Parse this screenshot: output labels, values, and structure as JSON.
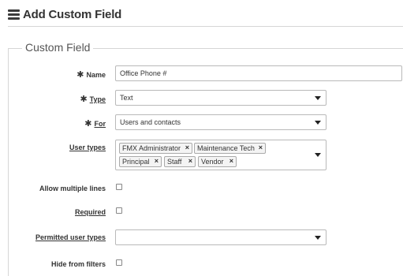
{
  "page": {
    "title": "Add Custom Field",
    "icon": "list-icon"
  },
  "fieldset": {
    "legend": "Custom Field"
  },
  "form": {
    "name": {
      "label": "Name",
      "value": "Office Phone #"
    },
    "type": {
      "label": "Type",
      "value": "Text"
    },
    "for": {
      "label": "For",
      "value": "Users and contacts"
    },
    "user_types": {
      "label": "User types",
      "tags": [
        "FMX Administrator",
        "Maintenance Tech",
        "Principal",
        "Staff",
        "Vendor"
      ],
      "remove_glyph": "×"
    },
    "allow_multiple_lines": {
      "label": "Allow multiple lines",
      "checked": false
    },
    "required": {
      "label": "Required",
      "checked": false
    },
    "permitted_user_types": {
      "label": "Permitted user types",
      "value": ""
    },
    "hide_from_filters": {
      "label": "Hide from filters",
      "checked": false
    }
  },
  "required_marker": "✱"
}
